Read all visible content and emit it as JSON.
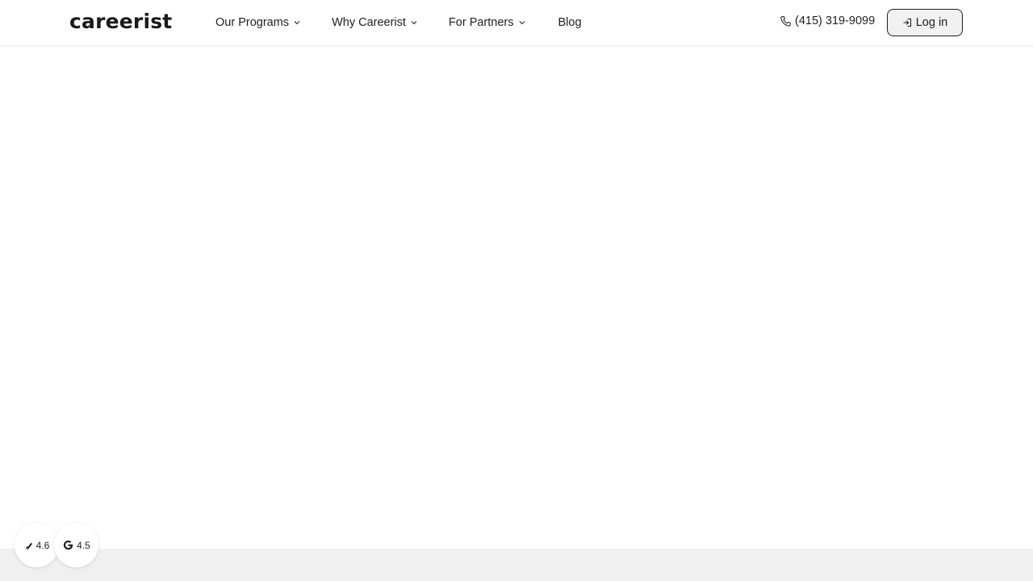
{
  "header": {
    "logo_text": "careerist",
    "nav": [
      {
        "label": "Our Programs",
        "has_dropdown": true
      },
      {
        "label": "Why Careerist",
        "has_dropdown": true
      },
      {
        "label": "For Partners",
        "has_dropdown": true
      },
      {
        "label": "Blog",
        "has_dropdown": false
      }
    ],
    "phone": "(415) 319-9099",
    "login_label": "Log in"
  },
  "ratings": [
    {
      "icon": "trustpilot-style-icon",
      "value": "4.6"
    },
    {
      "icon": "google-icon",
      "value": "4.5"
    }
  ],
  "colors": {
    "text": "#1f1f1f",
    "login_bg": "#f1f1f1",
    "footer_band": "#f0f0f0"
  }
}
